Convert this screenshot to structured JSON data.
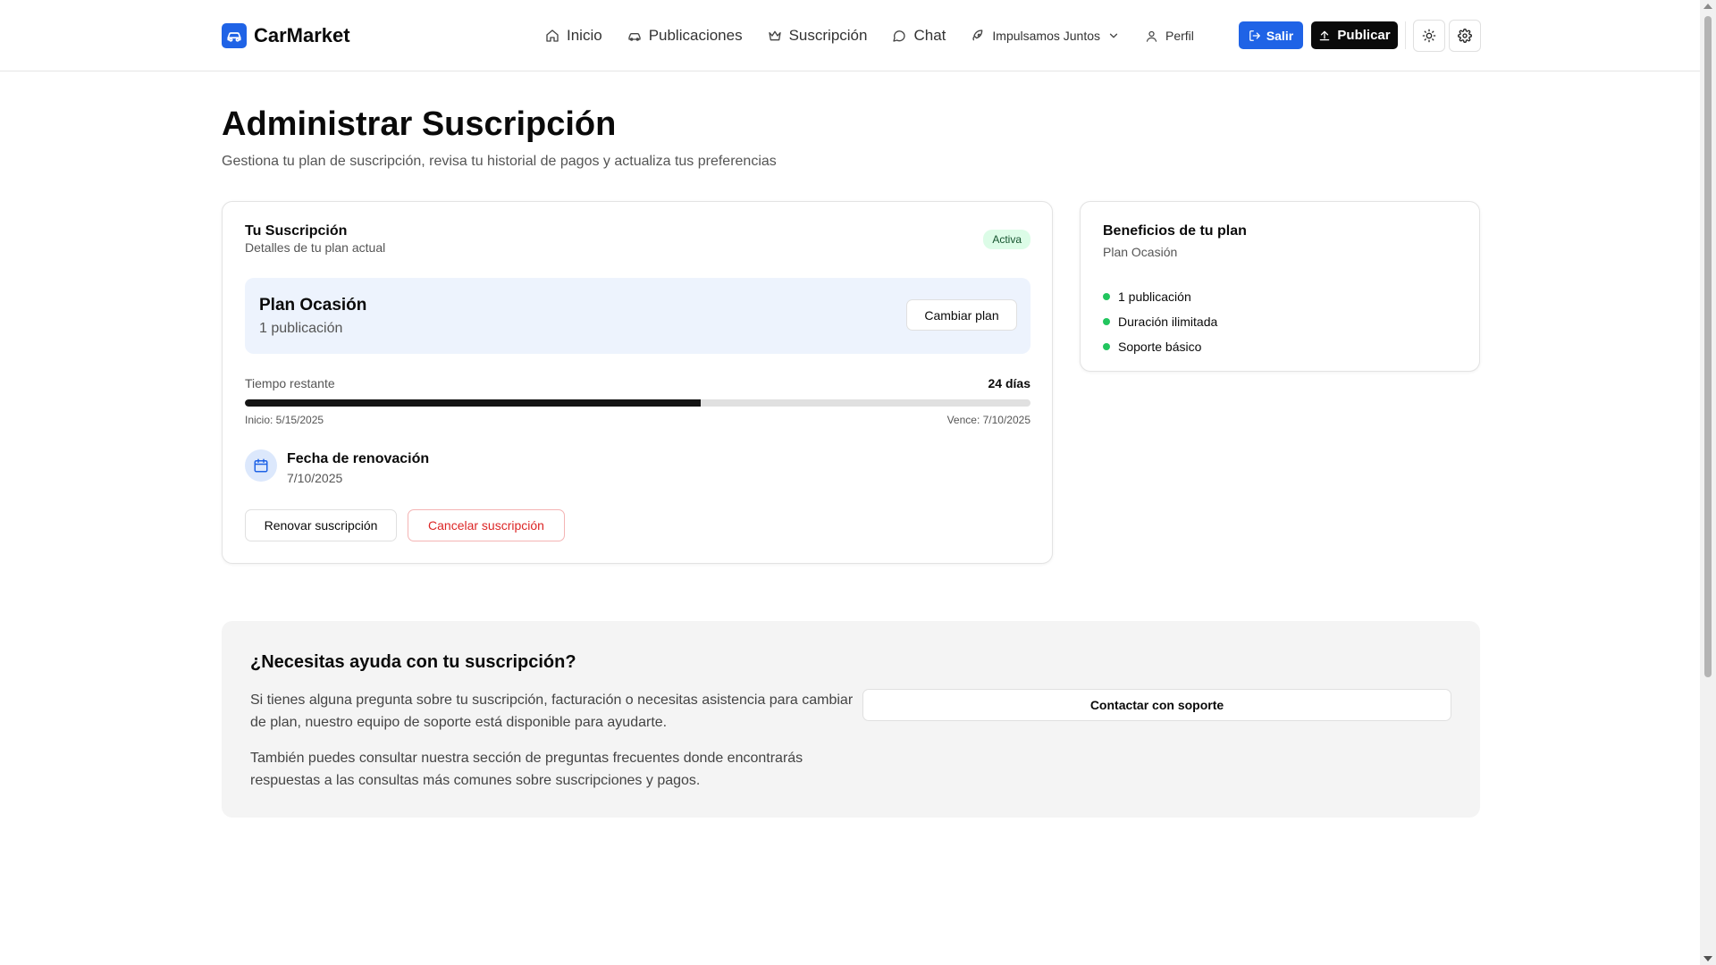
{
  "header": {
    "brand": "CarMarket",
    "nav": [
      {
        "label": "Inicio",
        "icon": "home-icon"
      },
      {
        "label": "Publicaciones",
        "icon": "car-icon"
      },
      {
        "label": "Suscripción",
        "icon": "crown-icon"
      },
      {
        "label": "Chat",
        "icon": "chat-icon"
      },
      {
        "label": "Impulsamos Juntos",
        "icon": "rocket-icon"
      },
      {
        "label": "Perfil",
        "icon": "user-icon"
      }
    ],
    "logout_label": "Salir",
    "publish_label": "Publicar",
    "accent_color": "#1f63e6"
  },
  "page": {
    "title": "Administrar Suscripción",
    "subtitle": "Gestiona tu plan de suscripción, revisa tu historial de pagos y actualiza tus preferencias"
  },
  "subscription": {
    "title": "Tu Suscripción",
    "description": "Detalles de tu plan actual",
    "status": "Activa",
    "plan_name": "Plan Ocasión",
    "plan_detail": "1 publicación",
    "change_plan_label": "Cambiar plan",
    "time_label": "Tiempo restante",
    "time_value": "24 días",
    "progress_fraction": 0.58,
    "start_label": "Inicio: 5/15/2025",
    "end_label": "Vence: 7/10/2025",
    "renewal_label": "Fecha de renovación",
    "renewal_date": "7/10/2025",
    "renew_button": "Renovar suscripción",
    "cancel_button": "Cancelar suscripción"
  },
  "benefits": {
    "title": "Beneficios de tu plan",
    "plan": "Plan Ocasión",
    "items": [
      "1 publicación",
      "Duración ilimitada",
      "Soporte básico"
    ]
  },
  "help": {
    "title": "¿Necesitas ayuda con tu suscripción?",
    "paragraph1": "Si tienes alguna pregunta sobre tu suscripción, facturación o necesitas asistencia para cambiar de plan, nuestro equipo de soporte está disponible para ayudarte.",
    "paragraph2": "También puedes consultar nuestra sección de preguntas frecuentes donde encontrarás respuestas a las consultas más comunes sobre suscripciones y pagos.",
    "support_button": "Contactar con soporte"
  }
}
